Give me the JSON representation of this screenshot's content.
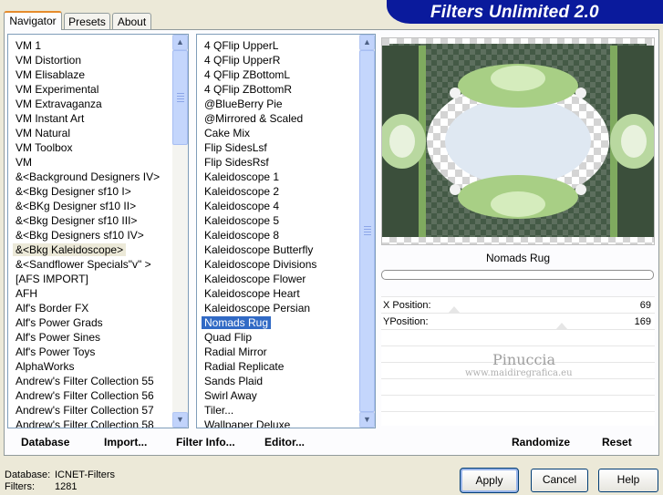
{
  "banner_title": "Filters Unlimited 2.0",
  "tabs": [
    "Navigator",
    "Presets",
    "About"
  ],
  "left_list": [
    "VM 1",
    "VM Distortion",
    "VM Elisablaze",
    "VM Experimental",
    "VM Extravaganza",
    "VM Instant Art",
    "VM Natural",
    "VM Toolbox",
    "VM",
    "&<Background Designers IV>",
    "&<Bkg Designer sf10 I>",
    "&<BKg Designer sf10 II>",
    "&<Bkg Designer sf10 III>",
    "&<Bkg Designers sf10 IV>",
    "&<Bkg Kaleidoscope>",
    "&<Sandflower Specials\"v\" >",
    "[AFS IMPORT]",
    "AFH",
    "Alf's Border FX",
    "Alf's Power Grads",
    "Alf's Power Sines",
    "Alf's Power Toys",
    "AlphaWorks",
    "Andrew's Filter Collection 55",
    "Andrew's Filter Collection 56",
    "Andrew's Filter Collection 57",
    "Andrew's Filter Collection 58"
  ],
  "left_selected": "&<Bkg Kaleidoscope>",
  "right_list": [
    "4 QFlip UpperL",
    "4 QFlip UpperR",
    "4 QFlip ZBottomL",
    "4 QFlip ZBottomR",
    "@BlueBerry Pie",
    "@Mirrored & Scaled",
    "Cake Mix",
    "Flip SidesLsf",
    "Flip SidesRsf",
    "Kaleidoscope 1",
    "Kaleidoscope 2",
    "Kaleidoscope 4",
    "Kaleidoscope 5",
    "Kaleidoscope 8",
    "Kaleidoscope Butterfly",
    "Kaleidoscope Divisions",
    "Kaleidoscope Flower",
    "Kaleidoscope Heart",
    "Kaleidoscope Persian",
    "Nomads Rug",
    "Quad Flip",
    "Radial Mirror",
    "Radial Replicate",
    "Sands Plaid",
    "Swirl Away",
    "Tiler...",
    "Wallpaper Deluxe"
  ],
  "right_selected": "Nomads Rug",
  "filter_name": "Nomads Rug",
  "params": [
    {
      "label": "X Position:",
      "value": "69"
    },
    {
      "label": "YPosition:",
      "value": "169"
    }
  ],
  "watermark": {
    "line1": "Pinuccia",
    "line2": "www.maidiregrafica.eu"
  },
  "bottom_buttons": {
    "database": "Database",
    "import": "Import...",
    "filter_info": "Filter Info...",
    "editor": "Editor...",
    "randomize": "Randomize",
    "reset": "Reset"
  },
  "status": {
    "database_label": "Database:",
    "database_value": "ICNET-Filters",
    "filters_label": "Filters:",
    "filters_value": "1281"
  },
  "dialog_buttons": {
    "apply": "Apply",
    "cancel": "Cancel",
    "help": "Help"
  },
  "colors": {
    "banner": "#0a1a9c",
    "selection": "#316ac5",
    "preview_green": "#9cc47a",
    "preview_dark": "#3b4f3b"
  }
}
